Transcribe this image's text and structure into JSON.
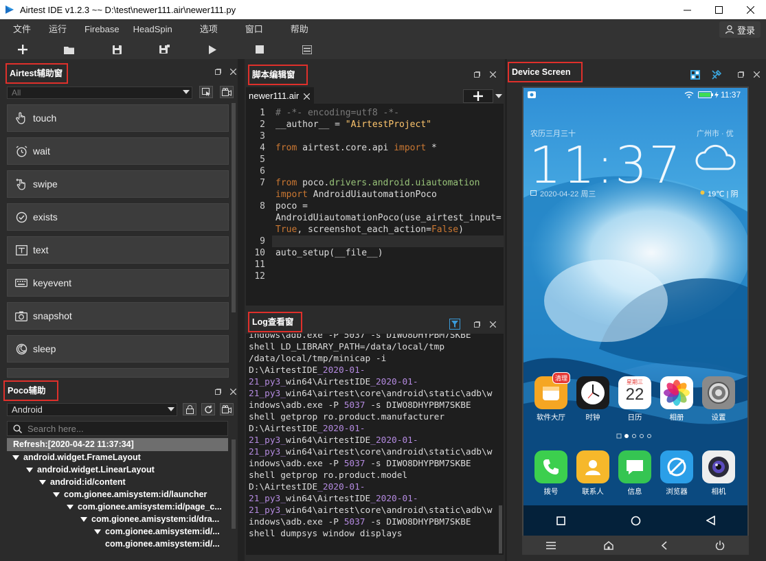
{
  "window": {
    "title": "Airtest IDE v1.2.3 ~~ D:\\test\\newer111.air\\newer111.py"
  },
  "menu": [
    "文件",
    "运行",
    "Firebase",
    "HeadSpin",
    "选项",
    "窗口",
    "帮助"
  ],
  "login_label": "登录",
  "airtest_panel": {
    "title": "Airtest辅助窗",
    "filter_value": "All",
    "apis": [
      "touch",
      "wait",
      "swipe",
      "exists",
      "text",
      "keyevent",
      "snapshot",
      "sleep"
    ]
  },
  "poco_panel": {
    "title": "Poco辅助窗",
    "mode": "Android",
    "search_placeholder": "Search here...",
    "refresh": "Refresh:[2020-04-22 11:37:34]",
    "tree": [
      "android.widget.FrameLayout",
      "android.widget.LinearLayout",
      "android:id/content",
      "com.gionee.amisystem:id/launcher",
      "com.gionee.amisystem:id/page_c...",
      "com.gionee.amisystem:id/dra...",
      "com.gionee.amisystem:id/...",
      "com.gionee.amisystem:id/..."
    ]
  },
  "editor_panel": {
    "title": "脚本编辑窗",
    "tab_name": "newer111.air",
    "line_numbers": [
      "1",
      "2",
      "3",
      "4",
      "5",
      "6",
      "7",
      "8",
      "9",
      "10",
      "11",
      "12"
    ],
    "code": {
      "l1": "# -*- encoding=utf8 -*-",
      "l2a": "__author__ = ",
      "l2b": "\"AirtestProject\"",
      "l4a": "from",
      "l4b": " airtest.core.api ",
      "l4c": "import",
      "l4d": " *",
      "l7a": "from",
      "l7b": " poco.",
      "l7c": "drivers.android.uiautomation",
      "l7d": "import",
      "l7e": " AndroidUiautomationPoco",
      "l8a": "poco =",
      "l8b": "AndroidUiautomationPoco(use_airtest_input=",
      "l8c": "True",
      "l8d": ", screenshot_each_action=",
      "l8e": "False",
      "l8f": ")",
      "l10": "auto_setup(__file__)"
    }
  },
  "log_panel": {
    "title": "Log查看窗",
    "l0": "indows\\adb.exe -P 5037 -s DIWO8DHYPBM7SKBE",
    "l1": "shell LD_LIBRARY_PATH=/data/local/tmp",
    "l2": "/data/local/tmp/minicap -i",
    "l3a": "D:\\AirtestIDE",
    "l3b": "_2020-01-",
    "l4a": "21",
    "l4b": "_py3_",
    "l4c": "win64\\AirtestIDE",
    "l4d": "_2020-01-",
    "l5a": "21",
    "l5b": "_py3_",
    "l5c": "win64\\airtest\\core\\android\\static\\adb\\w",
    "l6a": "indows\\adb.exe -P ",
    "l6b": "5037",
    "l6c": " -s DIWO8DHYPBM7SKBE",
    "l7": "shell getprop ro.product.manufacturer",
    "l8a": "D:\\AirtestIDE",
    "l8b": "_2020-01-",
    "l9a": "21",
    "l9b": "_py3_",
    "l9c": "win64\\AirtestIDE",
    "l9d": "_2020-01-",
    "l10a": "21",
    "l10b": "_py3_",
    "l10c": "win64\\airtest\\core\\android\\static\\adb\\w",
    "l11a": "indows\\adb.exe -P ",
    "l11b": "5037",
    "l11c": " -s DIWO8DHYPBM7SKBE",
    "l12": "shell getprop ro.product.model",
    "l13a": "D:\\AirtestIDE",
    "l13b": "_2020-01-",
    "l14a": "21",
    "l14b": "_py3_",
    "l14c": "win64\\AirtestIDE",
    "l14d": "_2020-01-",
    "l15a": "21",
    "l15b": "_py3_",
    "l15c": "win64\\airtest\\core\\android\\static\\adb\\w",
    "l16a": "indows\\adb.exe -P ",
    "l16b": "5037",
    "l16c": " -s DIWO8DHYPBM7SKBE",
    "l17": "shell dumpsys window displays"
  },
  "device_panel": {
    "title": "Device Screen",
    "phone_time_small": "11:37",
    "clock": "11:37",
    "lunar": "农历三月三十",
    "city": "广州市 · 优",
    "date": "2020-04-22 周三",
    "weather": "19℃ | 阴",
    "apps_row1": [
      {
        "name": "软件大厅",
        "badge": "清理"
      },
      {
        "name": "时钟"
      },
      {
        "name": "日历",
        "weekday": "星期三",
        "day": "22"
      },
      {
        "name": "相册"
      },
      {
        "name": "设置"
      }
    ],
    "apps_row2": [
      "拨号",
      "联系人",
      "信息",
      "浏览器",
      "相机"
    ]
  }
}
